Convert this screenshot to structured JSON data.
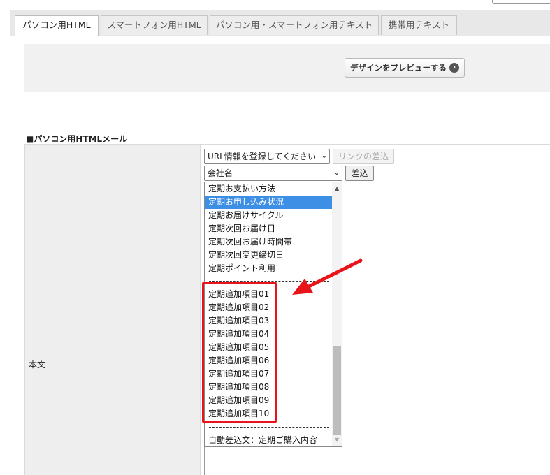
{
  "tabs": [
    {
      "label": "パソコン用HTML",
      "active": true
    },
    {
      "label": "スマートフォン用HTML",
      "active": false
    },
    {
      "label": "パソコン用・スマートフォン用テキスト",
      "active": false
    },
    {
      "label": "携帯用テキスト",
      "active": false
    }
  ],
  "preview": {
    "button_label": "デザインをプレビューする",
    "icon": "chevron-right-circle-icon"
  },
  "section": {
    "title": "■パソコン用HTMLメール"
  },
  "form": {
    "body_label": "本文",
    "url_select_value": "URL情報を登録してください",
    "link_insert_label": "リンクの差込",
    "field_select_value": "会社名",
    "insert_label": "差込"
  },
  "listbox": {
    "items_top": [
      "定期お支払い方法",
      "定期お申し込み状況",
      "定期お届けサイクル",
      "定期次回お届け日",
      "定期次回お届け時間帯",
      "定期次回変更締切日",
      "定期ポイント利用"
    ],
    "selected_index": 1,
    "items_highlighted": [
      "定期追加項目01",
      "定期追加項目02",
      "定期追加項目03",
      "定期追加項目04",
      "定期追加項目05",
      "定期追加項目06",
      "定期追加項目07",
      "定期追加項目08",
      "定期追加項目09",
      "定期追加項目10"
    ],
    "items_bottom": [
      "自動差込文：定期ご購入内容"
    ]
  },
  "annotation": {
    "highlight_color": "#e8141a",
    "selection_color": "#3d8fe6"
  }
}
